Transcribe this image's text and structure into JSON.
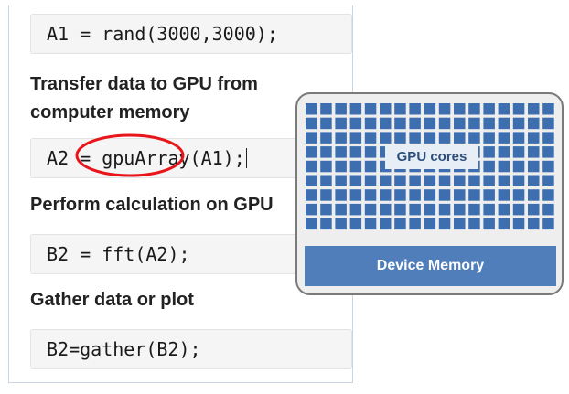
{
  "steps": [
    {
      "code": "A1 = rand(3000,3000);"
    },
    {
      "heading": "Transfer data to GPU from computer memory",
      "code": "A2 = gpuArray(A1);"
    },
    {
      "heading": "Perform calculation on GPU",
      "code": "B2 = fft(A2);"
    },
    {
      "heading": "Gather data or plot",
      "code": "B2=gather(B2);"
    }
  ],
  "gpu_diagram": {
    "cores_label": "GPU cores",
    "memory_label": "Device Memory",
    "core_color": "#3d6fb0",
    "memory_color": "#4f7eba",
    "highlight_color": "#e8161b"
  }
}
